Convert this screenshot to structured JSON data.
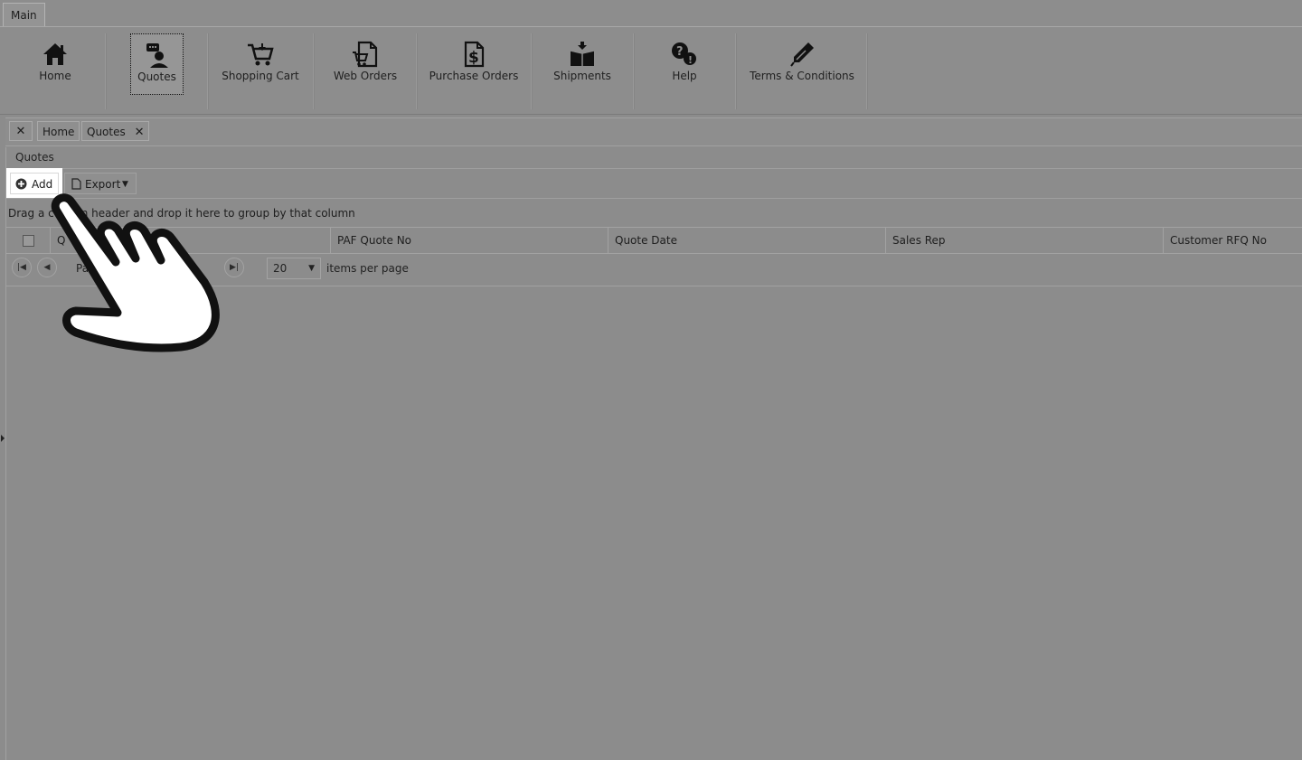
{
  "ribbon": {
    "tab_label": "Main",
    "buttons": [
      {
        "label": "Home",
        "icon": "home-icon"
      },
      {
        "label": "Quotes",
        "icon": "quotes-icon",
        "selected": true
      },
      {
        "label": "Shopping Cart",
        "icon": "shopping-cart-icon"
      },
      {
        "label": "Web Orders",
        "icon": "web-orders-icon"
      },
      {
        "label": "Purchase Orders",
        "icon": "purchase-orders-icon"
      },
      {
        "label": "Shipments",
        "icon": "shipments-icon"
      },
      {
        "label": "Help",
        "icon": "help-icon"
      },
      {
        "label": "Terms & Conditions",
        "icon": "terms-conditions-icon"
      }
    ]
  },
  "tabs": {
    "close_all_glyph": "✕",
    "home_label": "Home",
    "quotes_label": "Quotes",
    "quotes_close_glyph": "✕"
  },
  "panel": {
    "title": "Quotes",
    "add_label": "Add",
    "export_label": "Export",
    "grouping_hint": "Drag a column header and drop it here to group by that column"
  },
  "grid": {
    "columns": [
      "Q",
      "PAF Quote No",
      "Quote Date",
      "Sales Rep",
      "Customer RFQ No"
    ]
  },
  "pager": {
    "page_label": "Pa",
    "page_size": "20",
    "items_per_page": "items per page"
  },
  "colors": {
    "overlay_gray": "#8c8c8c",
    "highlight": "#ffffff"
  }
}
